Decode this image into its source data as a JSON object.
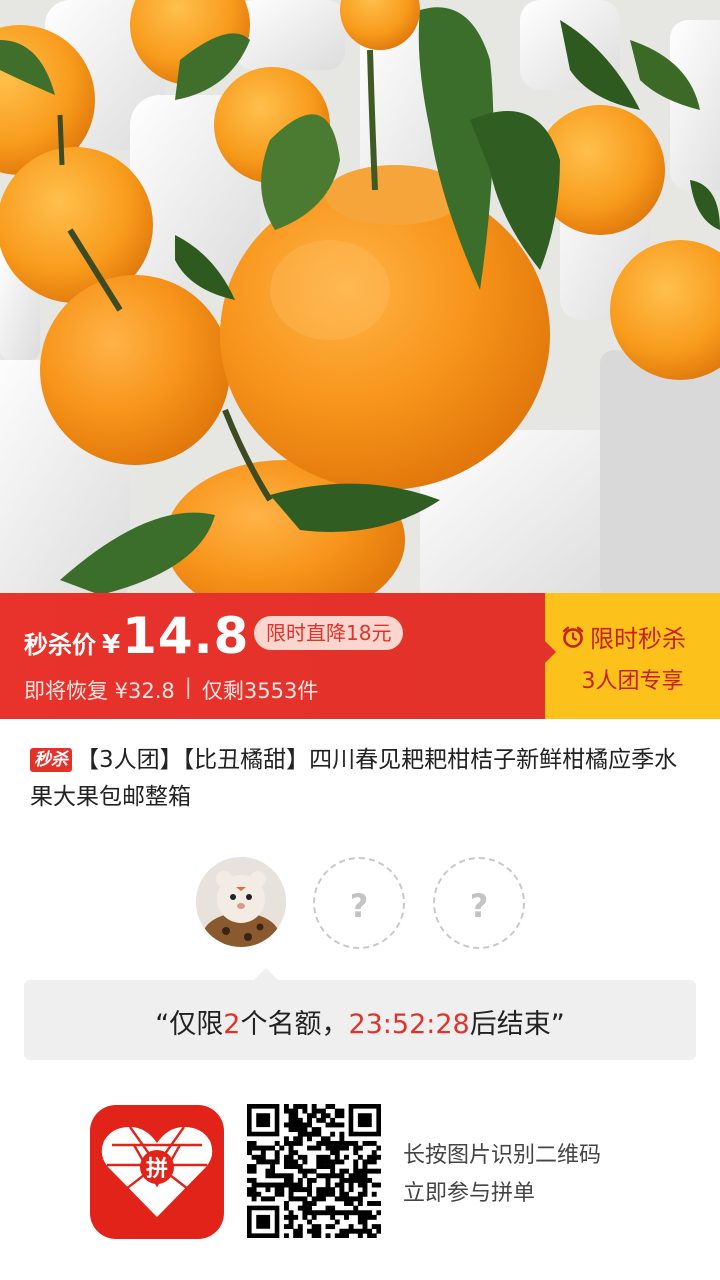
{
  "banner": {
    "price_label": "秒杀价",
    "currency": "¥",
    "price": "14.8",
    "drop_badge": "限时直降18元",
    "restore_text": "即将恢复 ¥32.8",
    "separator": "|",
    "remaining_text": "仅剩3553件",
    "flash_label": "限时秒杀",
    "group_label": "3人团专享",
    "colors": {
      "red": "#e2322a",
      "yellow": "#fcc11b"
    }
  },
  "title": {
    "tag": "秒杀",
    "text": "【3人团】【比丑橘甜】四川春见耙耙柑桔子新鲜柑橘应季水果大果包邮整箱"
  },
  "members": {
    "slot_placeholder": "?",
    "open_slots": 2
  },
  "quota": {
    "prefix": "“仅限",
    "count": "2",
    "middle": "个名额，",
    "countdown": "23:52:28",
    "suffix": "后结束”"
  },
  "footer": {
    "logo_char": "拼",
    "hint_line1": "长按图片识别二维码",
    "hint_line2": "立即参与拼单"
  }
}
